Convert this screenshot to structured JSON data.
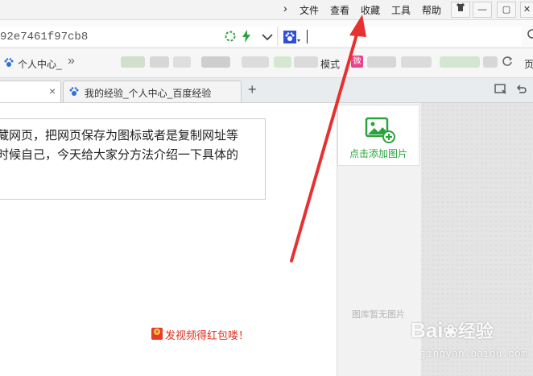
{
  "menu": {
    "chevron": "›",
    "file": "文件",
    "view": "查看",
    "favorites": "收藏",
    "tools": "工具",
    "help": "帮助"
  },
  "window_buttons": {
    "minimize": "—",
    "restore": "▢",
    "close": "✕"
  },
  "address": {
    "url": "92e7461f97cb8",
    "search_value": ""
  },
  "bookmarks": {
    "item1": "个人中心_",
    "more": "»",
    "item_mode": "模式",
    "item_badge": "微",
    "item_end": "页"
  },
  "tabs": [
    {
      "label": ""
    },
    {
      "label": "我的经验_个人中心_百度经验"
    }
  ],
  "tab_controls": {
    "close": "×",
    "new_tab": "+"
  },
  "content": {
    "line1": "藏网页，把网页保存为图标或者是复制网址等",
    "line2": "时候自己，今天给大家分方法介绍一下具体的",
    "red_packet_text": "发视频得红包喽！"
  },
  "side_panel": {
    "add_picture": "点击添加图片",
    "no_picture": "图库暂无图片"
  },
  "watermark": {
    "brand": "Bai",
    "brand_cn": "经验",
    "url": "jingyan.baidu.com"
  },
  "colors": {
    "accent_green": "#2aa33a",
    "arrow_red": "#e83030",
    "red_text": "#e0301e"
  }
}
